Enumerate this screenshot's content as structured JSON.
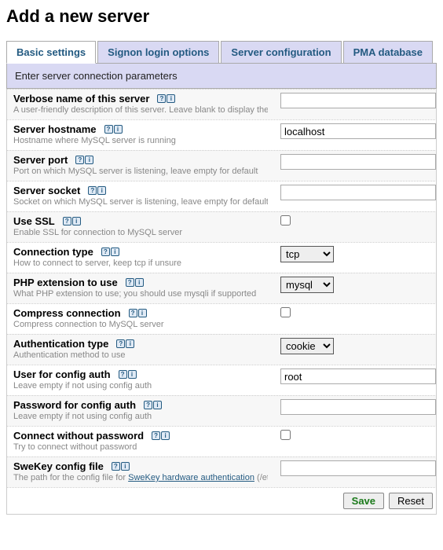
{
  "page_title": "Add a new server",
  "tabs": [
    {
      "label": "Basic settings",
      "active": true
    },
    {
      "label": "Signon login options",
      "active": false
    },
    {
      "label": "Server configuration",
      "active": false
    },
    {
      "label": "PMA database",
      "active": false
    }
  ],
  "section_header": "Enter server connection parameters",
  "help_q": "?",
  "help_i": "i",
  "fields": {
    "verbose": {
      "label": "Verbose name of this server",
      "desc": "A user-friendly description of this server. Leave blank to display the hostname instead",
      "type": "text",
      "value": ""
    },
    "hostname": {
      "label": "Server hostname",
      "desc": "Hostname where MySQL server is running",
      "type": "text",
      "value": "localhost"
    },
    "port": {
      "label": "Server port",
      "desc": "Port on which MySQL server is listening, leave empty for default",
      "type": "text",
      "value": ""
    },
    "socket": {
      "label": "Server socket",
      "desc": "Socket on which MySQL server is listening, leave empty for default",
      "type": "text",
      "value": ""
    },
    "ssl": {
      "label": "Use SSL",
      "desc": "Enable SSL for connection to MySQL server",
      "type": "checkbox",
      "value": false
    },
    "conntype": {
      "label": "Connection type",
      "desc": "How to connect to server, keep tcp if unsure",
      "type": "select",
      "value": "tcp"
    },
    "phpext": {
      "label": "PHP extension to use",
      "desc": "What PHP extension to use; you should use mysqli if supported",
      "type": "select",
      "value": "mysql"
    },
    "compress": {
      "label": "Compress connection",
      "desc": "Compress connection to MySQL server",
      "type": "checkbox",
      "value": false
    },
    "authtype": {
      "label": "Authentication type",
      "desc": "Authentication method to use",
      "type": "select",
      "value": "cookie"
    },
    "user": {
      "label": "User for config auth",
      "desc": "Leave empty if not using config auth",
      "type": "text",
      "value": "root"
    },
    "password": {
      "label": "Password for config auth",
      "desc": "Leave empty if not using config auth",
      "type": "password",
      "value": ""
    },
    "nopass": {
      "label": "Connect without password",
      "desc": "Try to connect without password",
      "type": "checkbox",
      "value": false
    },
    "swekey": {
      "label": "SweKey config file",
      "desc_pre": "The path for the config file for ",
      "desc_link": "SweKey hardware authentication",
      "desc_post": " (/etc/swekey.conf)",
      "type": "text",
      "value": ""
    }
  },
  "buttons": {
    "save": "Save",
    "reset": "Reset"
  }
}
